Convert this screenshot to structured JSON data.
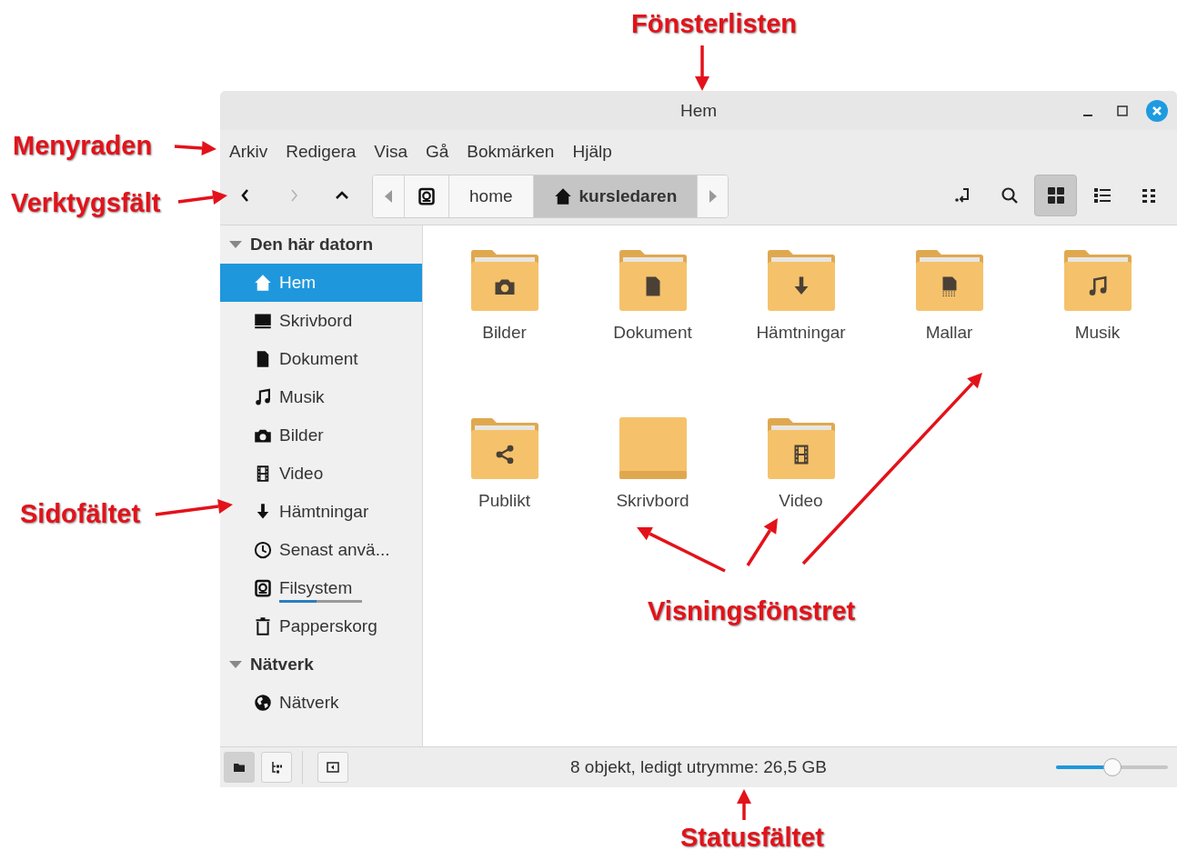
{
  "annotations": [
    {
      "label": "Fönsterlisten"
    },
    {
      "label": "Menyraden"
    },
    {
      "label": "Verktygsfält"
    },
    {
      "label": "Sidofältet"
    },
    {
      "label": "Visningsfönstret"
    },
    {
      "label": "Statusfältet"
    }
  ],
  "window": {
    "title": "Hem"
  },
  "menu": [
    "Arkiv",
    "Redigera",
    "Visa",
    "Gå",
    "Bokmärken",
    "Hjälp"
  ],
  "toolbar": {
    "nav": [
      {
        "kind": "back",
        "disabled": false
      },
      {
        "kind": "forward",
        "disabled": true
      },
      {
        "kind": "up",
        "disabled": false
      }
    ],
    "path": [
      {
        "kind": "drive",
        "selected": false
      },
      {
        "label": "home",
        "selected": false
      },
      {
        "label": "kursledaren",
        "kind": "home",
        "selected": true
      }
    ],
    "views": [
      {
        "kind": "icons",
        "selected": true
      },
      {
        "kind": "list",
        "selected": false
      },
      {
        "kind": "compact",
        "selected": false
      }
    ]
  },
  "sidebar": {
    "sections": [
      {
        "title": "Den här datorn",
        "expanded": true,
        "items": [
          {
            "label": "Hem",
            "kind": "home",
            "selected": true
          },
          {
            "label": "Skrivbord",
            "kind": "desktop",
            "selected": false
          },
          {
            "label": "Dokument",
            "kind": "document",
            "selected": false
          },
          {
            "label": "Musik",
            "kind": "music",
            "selected": false
          },
          {
            "label": "Bilder",
            "kind": "camera",
            "selected": false
          },
          {
            "label": "Video",
            "kind": "film",
            "selected": false
          },
          {
            "label": "Hämtningar",
            "kind": "download",
            "selected": false
          },
          {
            "label": "Senast anvä...",
            "kind": "clock",
            "selected": false
          },
          {
            "label": "Filsystem",
            "kind": "drive",
            "selected": false,
            "level": 0.45
          },
          {
            "label": "Papperskorg",
            "kind": "trash",
            "selected": false
          }
        ]
      },
      {
        "title": "Nätverk",
        "expanded": true,
        "items": [
          {
            "label": "Nätverk",
            "kind": "globe",
            "selected": false
          }
        ]
      }
    ]
  },
  "files": [
    {
      "name": "Bilder",
      "kind": "camera"
    },
    {
      "name": "Dokument",
      "kind": "document"
    },
    {
      "name": "Hämtningar",
      "kind": "download"
    },
    {
      "name": "Mallar",
      "kind": "template"
    },
    {
      "name": "Musik",
      "kind": "music"
    },
    {
      "name": "Publikt",
      "kind": "share"
    },
    {
      "name": "Skrivbord",
      "kind": "desktop"
    },
    {
      "name": "Video",
      "kind": "film"
    }
  ],
  "status_bar": {
    "buttons": [
      {
        "kind": "places",
        "selected": true
      },
      {
        "kind": "tree",
        "selected": false
      }
    ],
    "text": "8 objekt, ledigt utrymme: 26,5 GB",
    "zoom": {
      "level": 0.5
    }
  }
}
